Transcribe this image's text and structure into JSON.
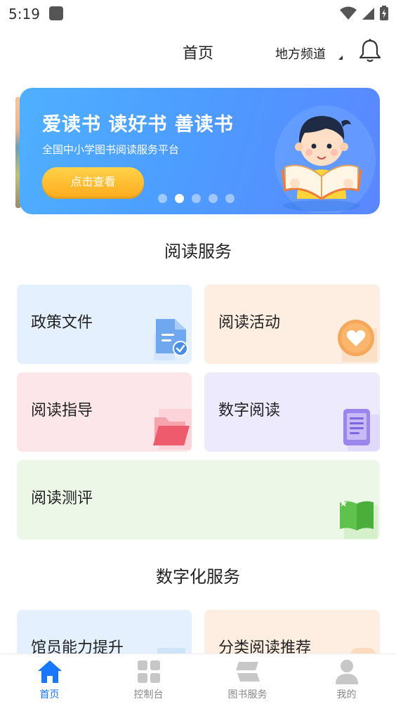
{
  "status_bar": {
    "time": "5:19"
  },
  "header": {
    "title": "首页",
    "channel": "地方频道"
  },
  "banner": {
    "title": "爱读书 读好书 善读书",
    "subtitle": "全国中小学图书阅读服务平台",
    "button": "点击查看",
    "dots": 5,
    "active_dot": 1
  },
  "reading_services": {
    "title": "阅读服务",
    "tiles": [
      {
        "label": "政策文件",
        "bg": "#e4f0fd",
        "icon": "document-check-icon"
      },
      {
        "label": "阅读活动",
        "bg": "#fdeee1",
        "icon": "heart-badge-icon"
      },
      {
        "label": "阅读指导",
        "bg": "#fde6ea",
        "icon": "folder-icon"
      },
      {
        "label": "数字阅读",
        "bg": "#eeeafd",
        "icon": "tablet-icon"
      },
      {
        "label": "阅读测评",
        "bg": "#ecf7e8",
        "icon": "open-book-icon"
      }
    ]
  },
  "digital_services": {
    "title": "数字化服务",
    "tiles": [
      {
        "label": "馆员能力提升",
        "bg": "#e4f0fd"
      },
      {
        "label": "分类阅读推荐",
        "bg": "#fdeee1"
      }
    ]
  },
  "bottom_nav": {
    "items": [
      {
        "label": "首页",
        "icon": "home-icon",
        "active": true
      },
      {
        "label": "控制台",
        "icon": "grid-icon",
        "active": false
      },
      {
        "label": "图书服务",
        "icon": "books-icon",
        "active": false
      },
      {
        "label": "我的",
        "icon": "user-icon",
        "active": false
      }
    ],
    "active_color": "#1976ff",
    "inactive_color": "#c7c7c7"
  }
}
